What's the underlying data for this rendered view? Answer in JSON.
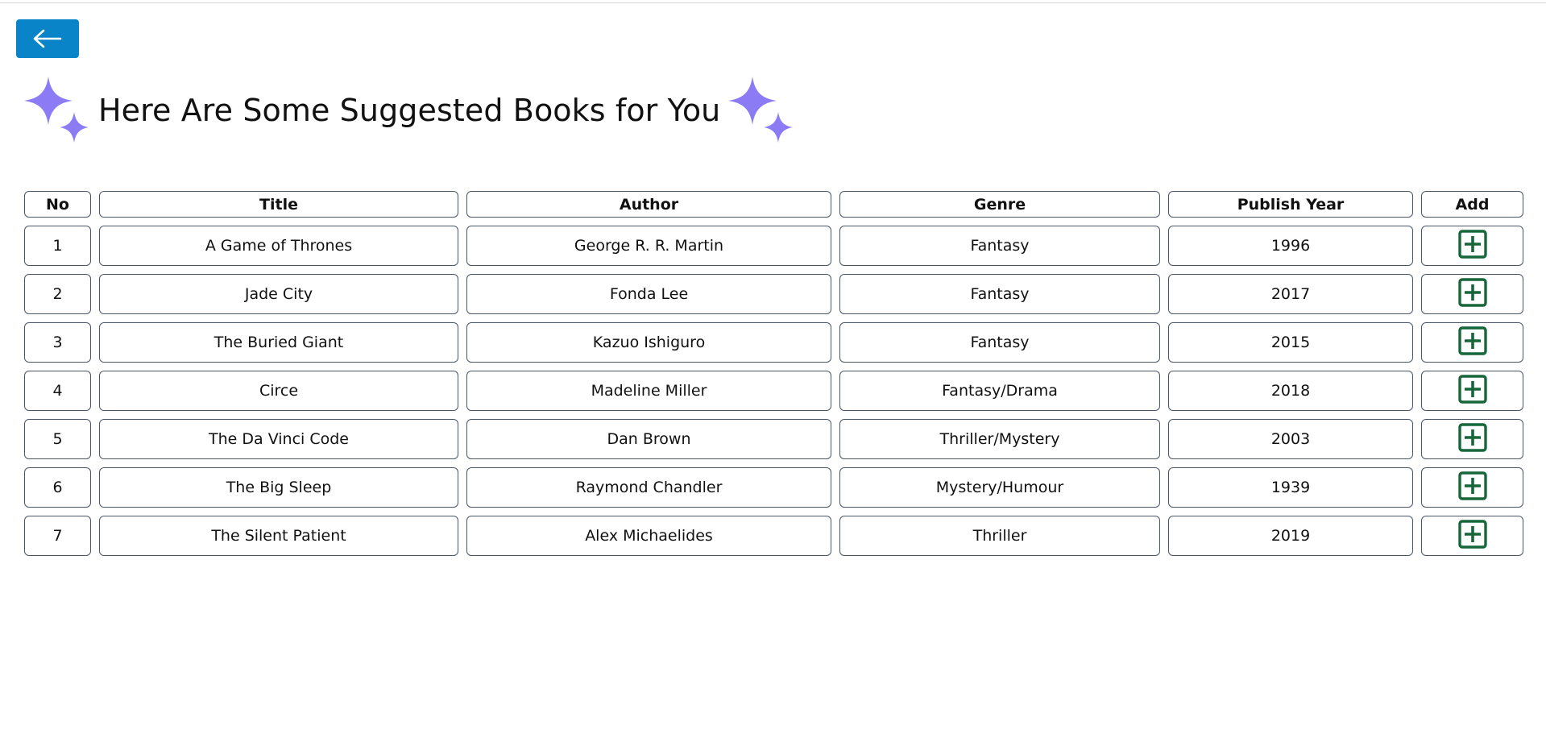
{
  "back_button": {
    "icon": "arrow-left-icon",
    "color": "#0a84c8"
  },
  "heading": {
    "title": "Here Are Some Suggested Books for You",
    "icon": "sparkles-icon",
    "icon_color": "#8b7cf6"
  },
  "table": {
    "columns": [
      "No",
      "Title",
      "Author",
      "Genre",
      "Publish Year",
      "Add"
    ],
    "rows": [
      {
        "no": "1",
        "title": "A Game of Thrones",
        "author": "George R. R. Martin",
        "genre": "Fantasy",
        "year": "1996"
      },
      {
        "no": "2",
        "title": "Jade City",
        "author": "Fonda Lee",
        "genre": "Fantasy",
        "year": "2017"
      },
      {
        "no": "3",
        "title": "The Buried Giant",
        "author": "Kazuo Ishiguro",
        "genre": "Fantasy",
        "year": "2015"
      },
      {
        "no": "4",
        "title": "Circe",
        "author": "Madeline Miller",
        "genre": "Fantasy/Drama",
        "year": "2018"
      },
      {
        "no": "5",
        "title": "The Da Vinci Code",
        "author": "Dan Brown",
        "genre": "Thriller/Mystery",
        "year": "2003"
      },
      {
        "no": "6",
        "title": "The Big Sleep",
        "author": "Raymond Chandler",
        "genre": "Mystery/Humour",
        "year": "1939"
      },
      {
        "no": "7",
        "title": "The Silent Patient",
        "author": "Alex Michaelides",
        "genre": "Thriller",
        "year": "2019"
      }
    ],
    "add_icon": "plus-square-icon",
    "add_icon_color": "#17663a"
  }
}
